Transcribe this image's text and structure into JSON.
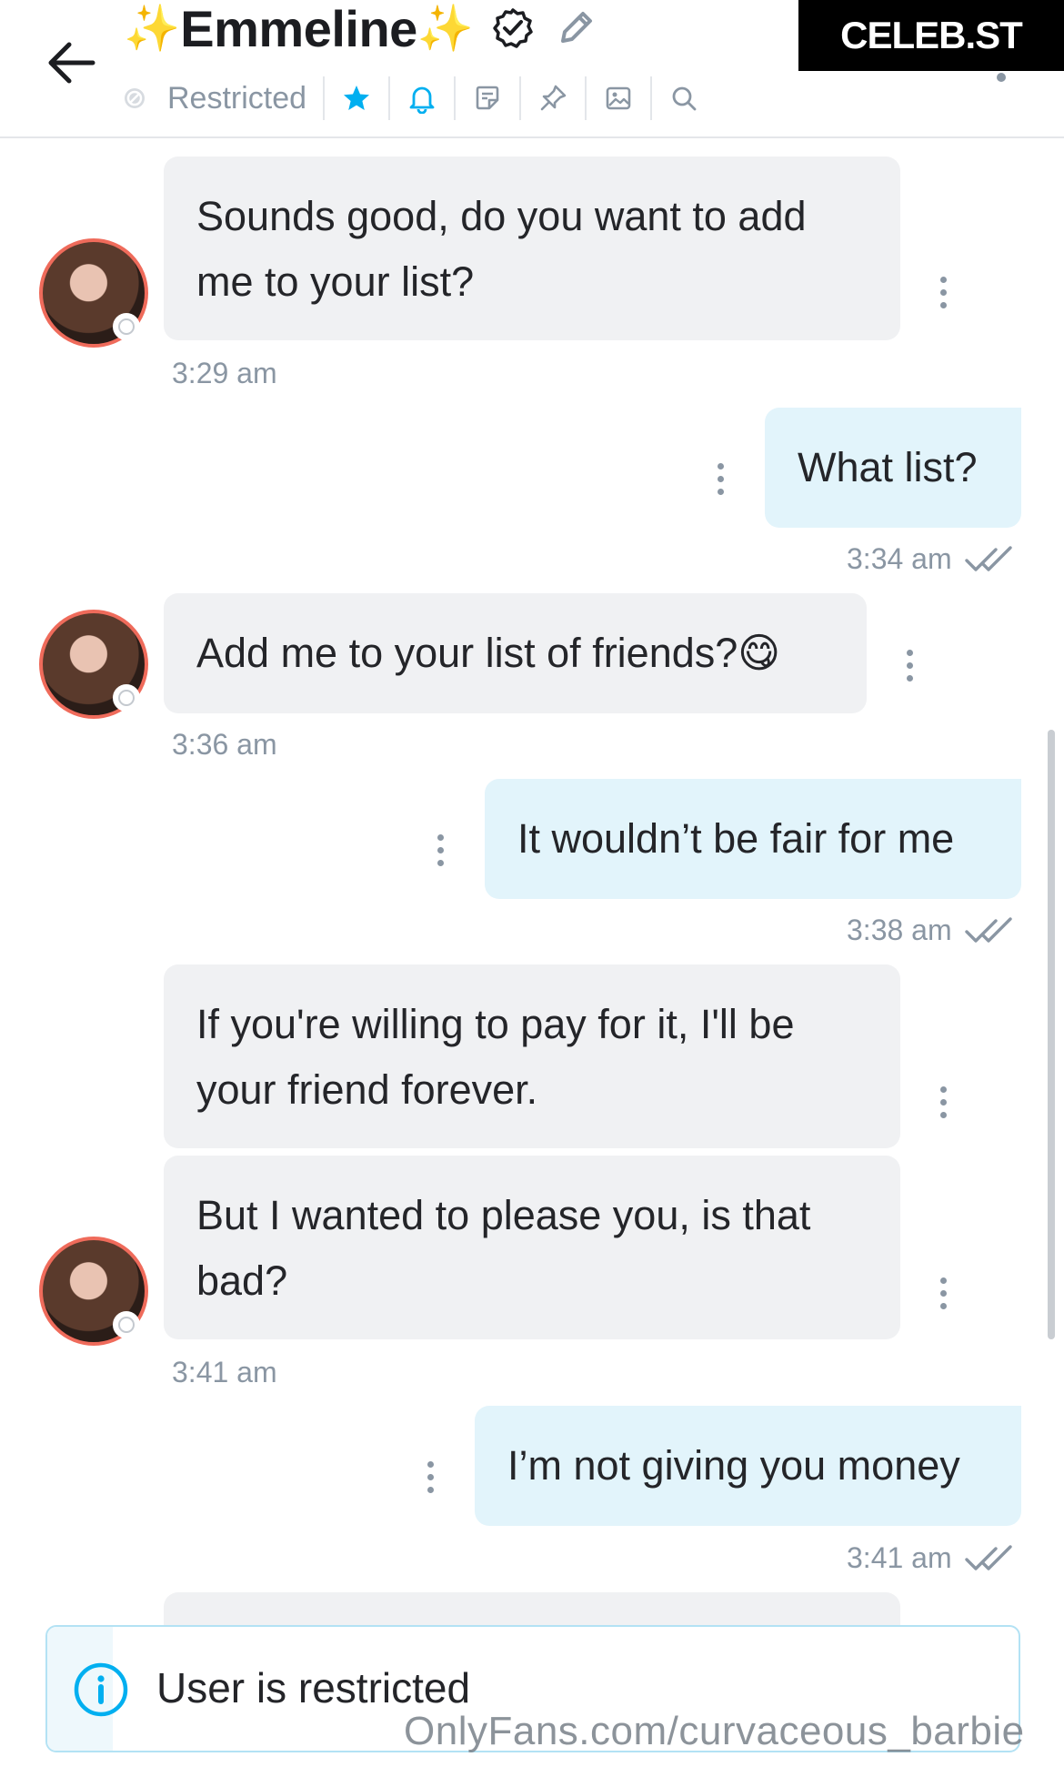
{
  "header": {
    "title_prefix_sparkle": "✨",
    "title": "Emmeline",
    "title_suffix_sparkle": "✨",
    "status_label": "Restricted",
    "brand": "CELEB.ST",
    "accent_color": "#00aff0"
  },
  "messages": [
    {
      "direction": "in",
      "text": "Sounds good, do you want to add me to your list?",
      "time": "3:29 am"
    },
    {
      "direction": "out",
      "text": "What list?",
      "time": "3:34 am"
    },
    {
      "direction": "in",
      "text": "Add me to your list of friends?😋",
      "time": "3:36 am"
    },
    {
      "direction": "out",
      "text": "It wouldn’t be fair for me",
      "time": "3:38 am"
    },
    {
      "direction": "in",
      "text": "If you're willing to pay for it, I'll be your friend forever.",
      "time": ""
    },
    {
      "direction": "in",
      "text": "But I wanted to please you, is that bad?",
      "time": "3:41 am"
    },
    {
      "direction": "out",
      "text": "I’m not giving you money",
      "time": "3:41 am"
    }
  ],
  "footer": {
    "notice": "User is restricted",
    "watermark": "OnlyFans.com/curvaceous_barbie"
  }
}
